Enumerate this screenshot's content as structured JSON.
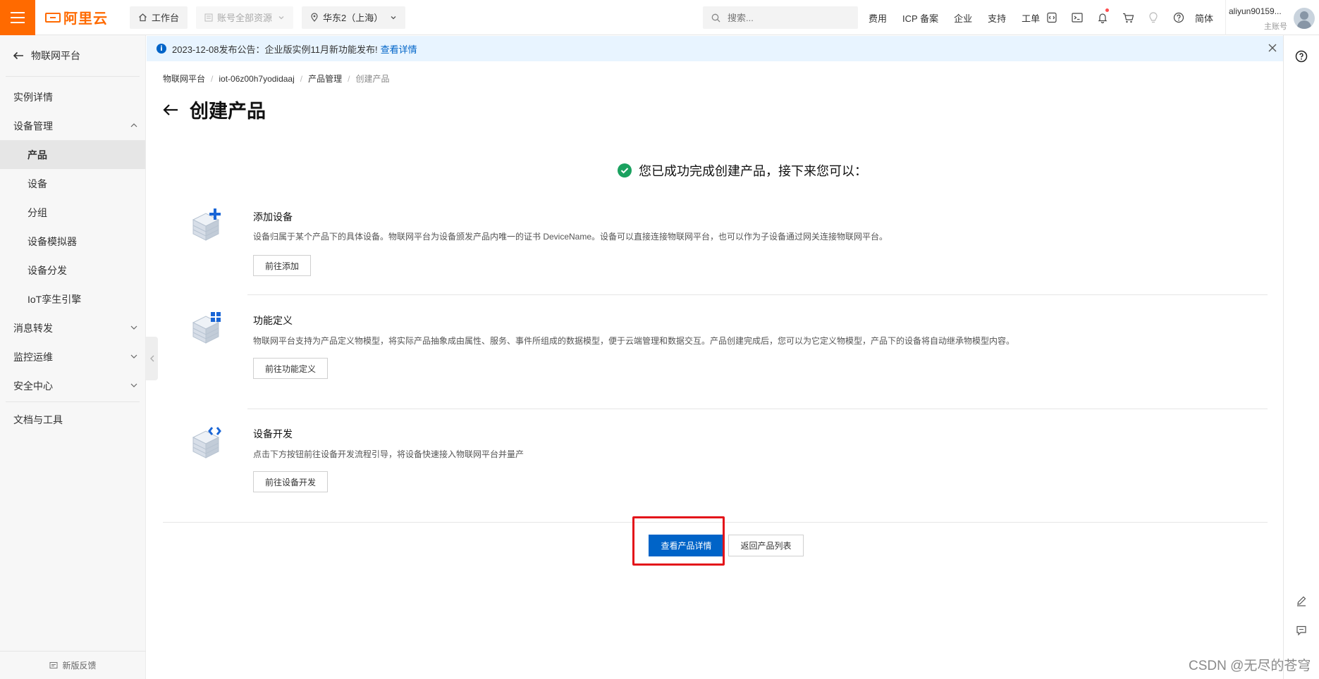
{
  "topbar": {
    "brand": "阿里云",
    "workbench": "工作台",
    "resource_scope": "账号全部资源",
    "region": "华东2（上海）",
    "search_placeholder": "搜索...",
    "links": [
      "费用",
      "ICP 备案",
      "企业",
      "支持",
      "工单"
    ],
    "icons": [
      "code-icon",
      "terminal-icon",
      "bell-icon",
      "cart-icon",
      "bulb-icon",
      "help-icon"
    ],
    "language": "简体",
    "user_name": "aliyun90159...",
    "user_role": "主账号"
  },
  "sidebar": {
    "back_title": "物联网平台",
    "items": [
      {
        "label": "实例详情",
        "level": 1
      },
      {
        "label": "设备管理",
        "level": 1,
        "expanded": true
      },
      {
        "label": "产品",
        "level": 2,
        "active": true
      },
      {
        "label": "设备",
        "level": 2
      },
      {
        "label": "分组",
        "level": 2
      },
      {
        "label": "设备模拟器",
        "level": 2
      },
      {
        "label": "设备分发",
        "level": 2
      },
      {
        "label": "IoT孪生引擎",
        "level": 2
      },
      {
        "label": "消息转发",
        "level": 1,
        "expanded": false
      },
      {
        "label": "监控运维",
        "level": 1,
        "expanded": false
      },
      {
        "label": "安全中心",
        "level": 1,
        "expanded": false
      },
      {
        "label": "文档与工具",
        "level": 1
      }
    ],
    "feedback": "新版反馈"
  },
  "notice": {
    "text": "2023-12-08发布公告：企业版实例11月新功能发布!",
    "link": "查看详情"
  },
  "breadcrumb": [
    "物联网平台",
    "iot-06z00h7yodidaaj",
    "产品管理",
    "创建产品"
  ],
  "page_title": "创建产品",
  "success_message": "您已成功完成创建产品，接下来您可以：",
  "steps": [
    {
      "title": "添加设备",
      "desc": "设备归属于某个产品下的具体设备。物联网平台为设备颁发产品内唯一的证书 DeviceName。设备可以直接连接物联网平台，也可以作为子设备通过网关连接物联网平台。",
      "button": "前往添加"
    },
    {
      "title": "功能定义",
      "desc": "物联网平台支持为产品定义物模型，将实际产品抽象成由属性、服务、事件所组成的数据模型，便于云端管理和数据交互。产品创建完成后，您可以为它定义物模型，产品下的设备将自动继承物模型内容。",
      "button": "前往功能定义"
    },
    {
      "title": "设备开发",
      "desc": "点击下方按钮前往设备开发流程引导，将设备快速接入物联网平台并量产",
      "button": "前往设备开发"
    }
  ],
  "actions": {
    "primary": "查看产品详情",
    "secondary": "返回产品列表"
  },
  "colors": {
    "brand_orange": "#ff6a00",
    "primary_blue": "#0064c8",
    "success_green": "#1aa15f",
    "highlight_red": "#e3141a"
  },
  "watermark": "CSDN @无尽的苍穹"
}
